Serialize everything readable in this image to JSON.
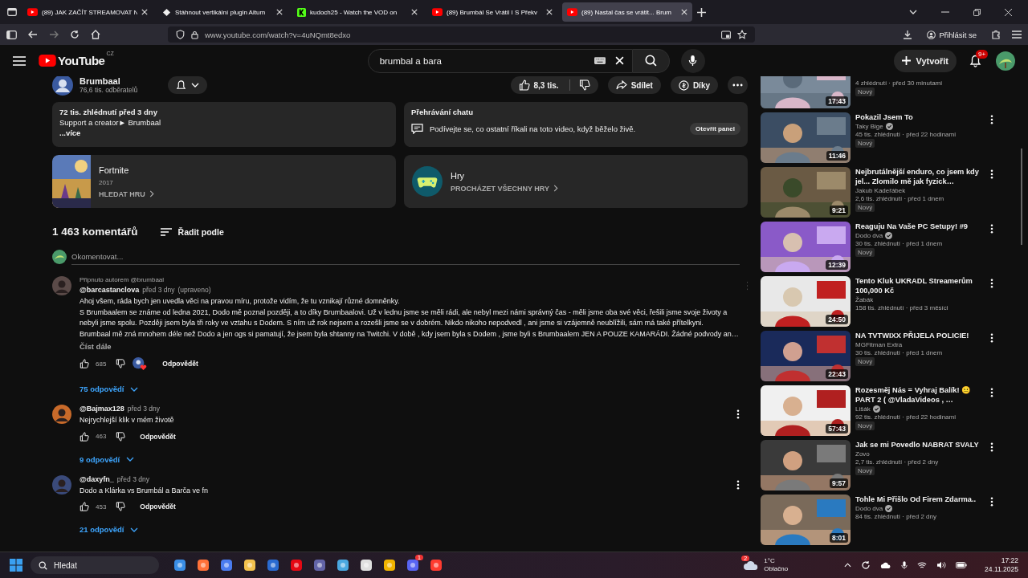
{
  "browser": {
    "tabs": [
      {
        "title": "(89) JAK ZAČÍT STREAMOVAT N",
        "kind": "youtube",
        "selected": false
      },
      {
        "title": "Stáhnout vertikální plugin Aitum",
        "kind": "aitum",
        "selected": false
      },
      {
        "title": "kudoch25 - Watch the VOD on",
        "kind": "kick",
        "selected": false
      },
      {
        "title": "(89) Brumbál Se Vrátil I S Překv",
        "kind": "youtube",
        "selected": false
      },
      {
        "title": "(89) Nastal čas se vrátit... Brum",
        "kind": "youtube",
        "selected": true
      }
    ],
    "url": "www.youtube.com/watch?v=4uNQmt8edxo",
    "sign_in": "Přihlásit se"
  },
  "youtube": {
    "logo": "YouTube",
    "country": "CZ",
    "search": {
      "value": "brumbal a bara"
    },
    "create": "Vytvořit",
    "notifications": "9+"
  },
  "video": {
    "channel": "Brumbaal",
    "subscribers": "76,6 tis. odběratelů",
    "likes": "8,3 tis.",
    "share": "Sdílet",
    "thanks": "Díky",
    "description": {
      "stats": "72 tis. zhlédnutí  před 3 dny",
      "lines": [
        "Support a creator► Brumbaal"
      ],
      "more": "...více"
    },
    "chat": {
      "title": "Přehrávání chatu",
      "text": "Podívejte se, co ostatní říkali na toto video, když běželo živě.",
      "button": "Otevřít panel"
    },
    "game": {
      "title": "Fortnite",
      "year": "2017",
      "link": "HLEDAT HRU"
    },
    "games": {
      "title": "Hry",
      "link": "PROCHÁZET VŠECHNY HRY"
    }
  },
  "comments": {
    "count": "1 463 komentářů",
    "sort": "Řadit podle",
    "placeholder": "Okomentovat...",
    "items": [
      {
        "pinned": "Připnuto autorem @brumbaal",
        "author": "@barcastanclova",
        "time": "před 3 dny",
        "edited": "(upraveno)",
        "lines": [
          "Ahoj všem, ráda bych jen uvedla věci na pravou míru, protože vidím, že tu vznikají různé domněnky.",
          "S Brumbaalem se známe od ledna 2021, Dodo mě poznal později, a to díky Brumbaalovi. Už v lednu  jsme se měli rádi, ale nebyl mezi námi správný čas - měli jsme oba své věci, řešili jsme svoje životy a",
          "nebyli jsme spolu. Později jsem byla tři roky ve vztahu s Dodem. S ním už rok nejsem a rozešli jsme se v dobrém. Nikdo nikoho nepodvedl , ani jsme si vzájemně neublížili, sám má také přítelkyni.",
          "Brumbaal mě zná mnohem déle než Dodo a jen ogs si pamatují, že jsem byla shtanny na Twitchi. V době , kdy jsem byla s Dodem , jsme byli s Brumbaalem JEN A POUZE KAMARÁDI. Žádné podvody an…"
        ],
        "read_more": "Číst dále",
        "likes": "685",
        "creator_heart": true,
        "reply": "Odpovědět",
        "replies": "75 odpovědí"
      },
      {
        "author": "@Bajmax128",
        "time": "před 3 dny",
        "lines": [
          "Nejrychlejší klik v mém životě"
        ],
        "likes": "463",
        "creator_heart": false,
        "reply": "Odpovědět",
        "replies": "9 odpovědí"
      },
      {
        "author": "@daxyfn_",
        "time": "před 3 dny",
        "lines": [
          "Dodo a Klárka vs Brumbál a Barča ve fn"
        ],
        "likes": "453",
        "creator_heart": false,
        "reply": "Odpovědět",
        "replies": "21 odpovědí"
      }
    ]
  },
  "related": [
    {
      "stats": "4 zhlédnutí · před 30 minutami",
      "new": "Nový",
      "duration": "17:43"
    },
    {
      "title": "Pokazil Jsem To",
      "channel": "Taky Bige",
      "verified": true,
      "stats": "45 tis. zhlédnutí · před 22 hodinami",
      "new": "Nový",
      "duration": "11:46"
    },
    {
      "title": "Nejbrutálnější enduro, co jsem kdy jel... Zlomilo mě jak fyzick…",
      "channel": "Jakub Kadeřábek",
      "verified": false,
      "stats": "2,6 tis. zhlédnutí · před 1 dnem",
      "new": "Nový",
      "duration": "9:21"
    },
    {
      "title": "Reaguju Na Vaše PC Setupy! #9",
      "channel": "Dodo dva",
      "verified": true,
      "stats": "30 tis. zhlédnutí · před 1 dnem",
      "new": "Nový",
      "duration": "12:39"
    },
    {
      "title": "Tento Kluk UKRADL Streamerům 100,000 Kč",
      "channel": "Žabák",
      "verified": false,
      "stats": "158 tis. zhlédnutí · před 3 měsíci",
      "duration": "24:50"
    },
    {
      "title": "NA TVTWIXX PŘIJELA POLICIE!",
      "channel": "MGFitman Extra",
      "verified": false,
      "stats": "30 tis. zhlédnutí · před 1 dnem",
      "new": "Nový",
      "duration": "22:43"
    },
    {
      "title": "Rozesměj Nás = Vyhraj Balík! 😐 PART 2 ( @VladaVideos , …",
      "channel": "Lišák",
      "verified": true,
      "stats": "92 tis. zhlédnutí · před 22 hodinami",
      "new": "Nový",
      "duration": "57:43"
    },
    {
      "title": "Jak se mi Povedlo NABRAT SVALY",
      "channel": "Zovo",
      "verified": false,
      "stats": "2,7 tis. zhlédnutí · před 2 dny",
      "new": "Nový",
      "duration": "9:57"
    },
    {
      "title": "Tohle Mi Přišlo Od Firem Zdarma..",
      "channel": "Dodo dva",
      "verified": true,
      "stats": "84 tis. zhlédnutí · před 2 dny",
      "duration": "8:01"
    }
  ],
  "taskbar": {
    "search": "Hledat",
    "chat_badge": "1",
    "weather": {
      "badge": "2",
      "temp": "1°C",
      "text": "Oblačno"
    },
    "time": "17:22",
    "date": "24.11.2025"
  }
}
